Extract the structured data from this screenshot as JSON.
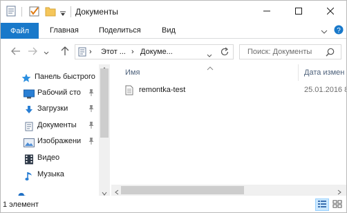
{
  "window": {
    "title": "Документы"
  },
  "ribbon": {
    "tabs": [
      {
        "label": "Файл"
      },
      {
        "label": "Главная"
      },
      {
        "label": "Поделиться"
      },
      {
        "label": "Вид"
      }
    ]
  },
  "address": {
    "crumbs": [
      "Этот ...",
      "Докуме..."
    ]
  },
  "search": {
    "placeholder": "Поиск: Документы"
  },
  "navpane": {
    "items": [
      {
        "label": "Панель быстрого",
        "icon": "star-icon"
      },
      {
        "label": "Рабочий сто",
        "icon": "desktop-icon",
        "pinned": true
      },
      {
        "label": "Загрузки",
        "icon": "download-icon",
        "pinned": true
      },
      {
        "label": "Документы",
        "icon": "document-icon",
        "pinned": true
      },
      {
        "label": "Изображени",
        "icon": "picture-icon",
        "pinned": true
      },
      {
        "label": "Видео",
        "icon": "video-icon"
      },
      {
        "label": "Музыка",
        "icon": "music-icon"
      }
    ]
  },
  "content": {
    "columns": [
      {
        "label": "Имя"
      },
      {
        "label": "Дата измен"
      }
    ],
    "files": [
      {
        "name": "remontka-test",
        "date": "25.01.2016 8"
      }
    ]
  },
  "status": {
    "text": "1 элемент"
  },
  "colors": {
    "accent": "#1979ca",
    "window_border": "#b9b9b9"
  }
}
